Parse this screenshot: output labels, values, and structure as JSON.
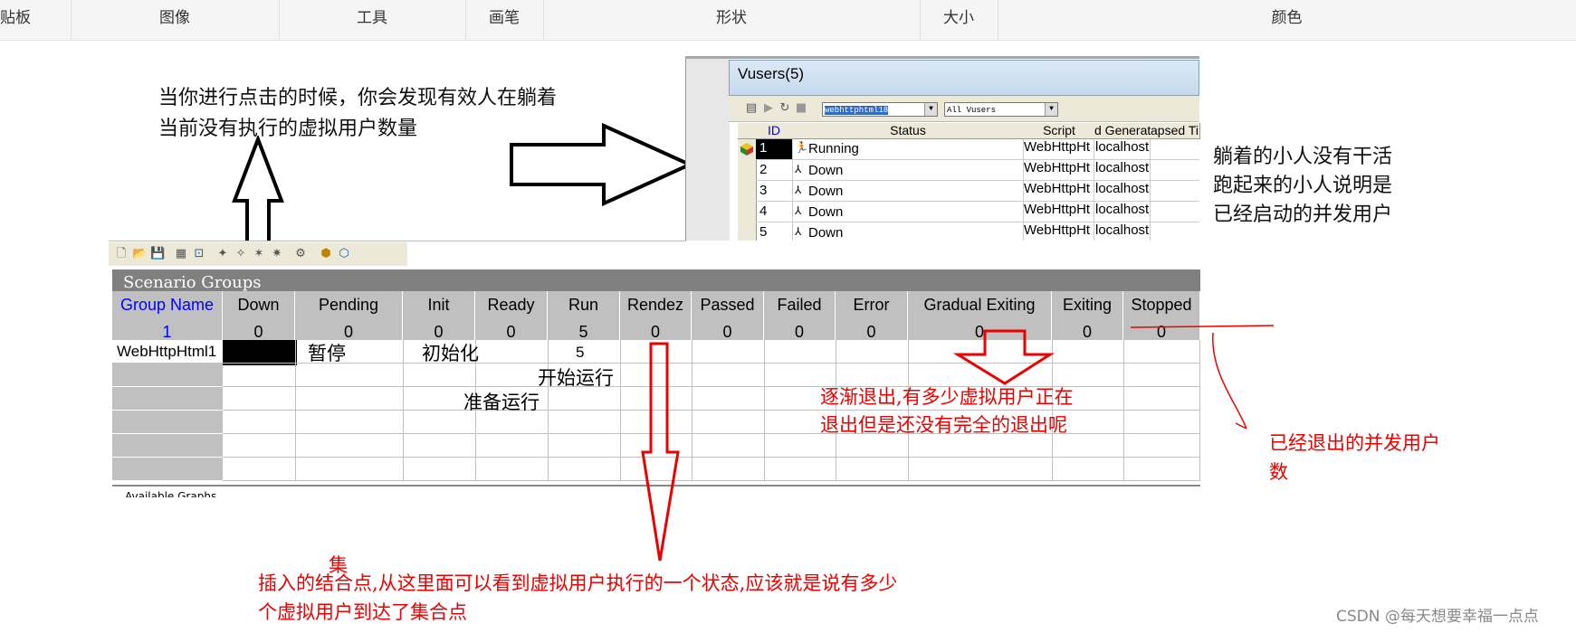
{
  "ribbon": {
    "items": [
      "贴板",
      "图像",
      "工具",
      "画笔",
      "形状",
      "大小",
      "颜色"
    ]
  },
  "notes": {
    "top_left_1": "当你进行点击的时候，你会发现有效人在躺着",
    "top_left_2": "当前没有执行的虚拟用户数量",
    "right_1": "躺着的小人没有干活",
    "right_2": "跑起来的小人说明是",
    "right_3": "已经启动的并发用户",
    "pause": "暂停",
    "init": "初始化",
    "run": "开始运行",
    "ready": "准备运行",
    "gradual_1": "逐渐退出,有多少虚拟用户正在",
    "gradual_2": "退出但是还没有完全的退出呢",
    "stopped_1": "已经退出的并发用户",
    "stopped_2": "数",
    "rendez_extra": "集",
    "rendez_1": "插入的结合点,从这里面可以看到虚拟用户执行的一个状态,应该就是说有多少",
    "rendez_2": "个虚拟用户到达了集合点"
  },
  "vusers": {
    "title": "Vusers(5)",
    "group_select": "webhttphtml18",
    "filter_select": "All Vusers",
    "columns": [
      "ID",
      "Status",
      "Script",
      "d Generat",
      "apsed Ti"
    ],
    "rows": [
      {
        "id": "1",
        "status": "Running",
        "script": "WebHttpHt",
        "gen": "localhost"
      },
      {
        "id": "2",
        "status": "Down",
        "script": "WebHttpHt",
        "gen": "localhost"
      },
      {
        "id": "3",
        "status": "Down",
        "script": "WebHttpHt",
        "gen": "localhost"
      },
      {
        "id": "4",
        "status": "Down",
        "script": "WebHttpHt",
        "gen": "localhost"
      },
      {
        "id": "5",
        "status": "Down",
        "script": "WebHttpHt",
        "gen": "localhost"
      }
    ]
  },
  "scenario": {
    "title": "Scenario Groups",
    "headers": [
      "Group Name",
      "Down",
      "Pending",
      "Init",
      "Ready",
      "Run",
      "Rendez",
      "Passed",
      "Failed",
      "Error",
      "Gradual Exiting",
      "Exiting",
      "Stopped"
    ],
    "totals": [
      "1",
      "0",
      "0",
      "0",
      "0",
      "5",
      "0",
      "0",
      "0",
      "0",
      "0",
      "0",
      "0"
    ],
    "row_group": "WebHttpHtml1",
    "row_run": "5",
    "footer": "Available Graphs"
  },
  "watermark": "CSDN @每天想要幸福一点点",
  "colors": {
    "annotation_red": "#e00000",
    "header_blue": "#0000ff",
    "grid_gray": "#c0c0c0"
  }
}
